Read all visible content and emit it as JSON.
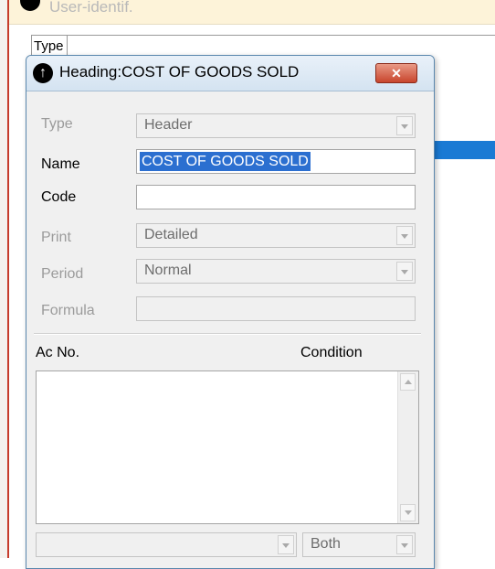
{
  "background": {
    "window_title": "User-identif.",
    "column_header": "Type"
  },
  "dialog": {
    "title": "Heading:COST OF GOODS SOLD",
    "close_label": "✕",
    "fields": {
      "type": {
        "label": "Type",
        "value": "Header"
      },
      "name": {
        "label": "Name",
        "value": "COST OF GOODS SOLD"
      },
      "code": {
        "label": "Code",
        "value": ""
      },
      "print": {
        "label": "Print",
        "value": "Detailed"
      },
      "period": {
        "label": "Period",
        "value": "Normal"
      },
      "formula": {
        "label": "Formula",
        "value": ""
      }
    },
    "list": {
      "col_acno": "Ac No.",
      "col_condition": "Condition"
    },
    "bottom": {
      "account_value": "",
      "condition_value": "Both"
    }
  },
  "colors": {
    "selection": "#2b6fd0",
    "close_button": "#c8452d",
    "titlebar": "#d4e3f1"
  }
}
